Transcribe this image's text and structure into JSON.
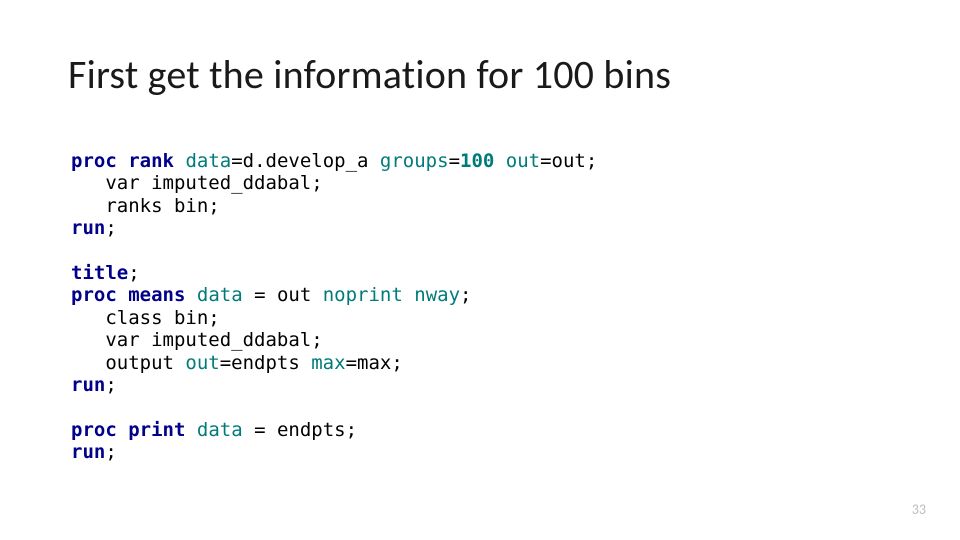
{
  "title": "First get the information for 100 bins",
  "page_number": "33",
  "code": {
    "l1": {
      "a": "proc",
      "b": "rank",
      "c": "data",
      "d": "=d.develop_a ",
      "e": "groups",
      "f": "=",
      "g": "100",
      "h": " out",
      "i": "=out;"
    },
    "l2": "   var imputed_ddabal;",
    "l3": "   ranks bin;",
    "l4": {
      "a": "run",
      "b": ";"
    },
    "l5": "",
    "l6": {
      "a": "title",
      "b": ";"
    },
    "l7": {
      "a": "proc",
      "b": "means",
      "c": "data",
      "d": " = out ",
      "e": "noprint",
      "f": "nway",
      "g": ";"
    },
    "l8": "   class bin;",
    "l9": "   var imputed_ddabal;",
    "l10": {
      "a": "   output ",
      "b": "out",
      "c": "=endpts ",
      "d": "max",
      "e": "=max;"
    },
    "l11": {
      "a": "run",
      "b": ";"
    },
    "l12": "",
    "l13": {
      "a": "proc",
      "b": "print",
      "c": "data",
      "d": " = endpts;"
    },
    "l14": {
      "a": "run",
      "b": ";"
    }
  }
}
